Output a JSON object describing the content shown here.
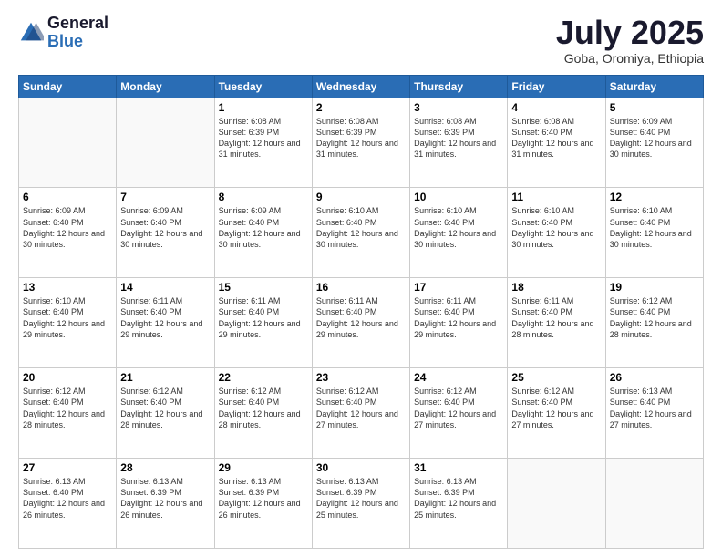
{
  "logo": {
    "general": "General",
    "blue": "Blue"
  },
  "title": "July 2025",
  "subtitle": "Goba, Oromiya, Ethiopia",
  "days_of_week": [
    "Sunday",
    "Monday",
    "Tuesday",
    "Wednesday",
    "Thursday",
    "Friday",
    "Saturday"
  ],
  "weeks": [
    [
      {
        "day": "",
        "info": ""
      },
      {
        "day": "",
        "info": ""
      },
      {
        "day": "1",
        "info": "Sunrise: 6:08 AM\nSunset: 6:39 PM\nDaylight: 12 hours and 31 minutes."
      },
      {
        "day": "2",
        "info": "Sunrise: 6:08 AM\nSunset: 6:39 PM\nDaylight: 12 hours and 31 minutes."
      },
      {
        "day": "3",
        "info": "Sunrise: 6:08 AM\nSunset: 6:39 PM\nDaylight: 12 hours and 31 minutes."
      },
      {
        "day": "4",
        "info": "Sunrise: 6:08 AM\nSunset: 6:40 PM\nDaylight: 12 hours and 31 minutes."
      },
      {
        "day": "5",
        "info": "Sunrise: 6:09 AM\nSunset: 6:40 PM\nDaylight: 12 hours and 30 minutes."
      }
    ],
    [
      {
        "day": "6",
        "info": "Sunrise: 6:09 AM\nSunset: 6:40 PM\nDaylight: 12 hours and 30 minutes."
      },
      {
        "day": "7",
        "info": "Sunrise: 6:09 AM\nSunset: 6:40 PM\nDaylight: 12 hours and 30 minutes."
      },
      {
        "day": "8",
        "info": "Sunrise: 6:09 AM\nSunset: 6:40 PM\nDaylight: 12 hours and 30 minutes."
      },
      {
        "day": "9",
        "info": "Sunrise: 6:10 AM\nSunset: 6:40 PM\nDaylight: 12 hours and 30 minutes."
      },
      {
        "day": "10",
        "info": "Sunrise: 6:10 AM\nSunset: 6:40 PM\nDaylight: 12 hours and 30 minutes."
      },
      {
        "day": "11",
        "info": "Sunrise: 6:10 AM\nSunset: 6:40 PM\nDaylight: 12 hours and 30 minutes."
      },
      {
        "day": "12",
        "info": "Sunrise: 6:10 AM\nSunset: 6:40 PM\nDaylight: 12 hours and 30 minutes."
      }
    ],
    [
      {
        "day": "13",
        "info": "Sunrise: 6:10 AM\nSunset: 6:40 PM\nDaylight: 12 hours and 29 minutes."
      },
      {
        "day": "14",
        "info": "Sunrise: 6:11 AM\nSunset: 6:40 PM\nDaylight: 12 hours and 29 minutes."
      },
      {
        "day": "15",
        "info": "Sunrise: 6:11 AM\nSunset: 6:40 PM\nDaylight: 12 hours and 29 minutes."
      },
      {
        "day": "16",
        "info": "Sunrise: 6:11 AM\nSunset: 6:40 PM\nDaylight: 12 hours and 29 minutes."
      },
      {
        "day": "17",
        "info": "Sunrise: 6:11 AM\nSunset: 6:40 PM\nDaylight: 12 hours and 29 minutes."
      },
      {
        "day": "18",
        "info": "Sunrise: 6:11 AM\nSunset: 6:40 PM\nDaylight: 12 hours and 28 minutes."
      },
      {
        "day": "19",
        "info": "Sunrise: 6:12 AM\nSunset: 6:40 PM\nDaylight: 12 hours and 28 minutes."
      }
    ],
    [
      {
        "day": "20",
        "info": "Sunrise: 6:12 AM\nSunset: 6:40 PM\nDaylight: 12 hours and 28 minutes."
      },
      {
        "day": "21",
        "info": "Sunrise: 6:12 AM\nSunset: 6:40 PM\nDaylight: 12 hours and 28 minutes."
      },
      {
        "day": "22",
        "info": "Sunrise: 6:12 AM\nSunset: 6:40 PM\nDaylight: 12 hours and 28 minutes."
      },
      {
        "day": "23",
        "info": "Sunrise: 6:12 AM\nSunset: 6:40 PM\nDaylight: 12 hours and 27 minutes."
      },
      {
        "day": "24",
        "info": "Sunrise: 6:12 AM\nSunset: 6:40 PM\nDaylight: 12 hours and 27 minutes."
      },
      {
        "day": "25",
        "info": "Sunrise: 6:12 AM\nSunset: 6:40 PM\nDaylight: 12 hours and 27 minutes."
      },
      {
        "day": "26",
        "info": "Sunrise: 6:13 AM\nSunset: 6:40 PM\nDaylight: 12 hours and 27 minutes."
      }
    ],
    [
      {
        "day": "27",
        "info": "Sunrise: 6:13 AM\nSunset: 6:40 PM\nDaylight: 12 hours and 26 minutes."
      },
      {
        "day": "28",
        "info": "Sunrise: 6:13 AM\nSunset: 6:39 PM\nDaylight: 12 hours and 26 minutes."
      },
      {
        "day": "29",
        "info": "Sunrise: 6:13 AM\nSunset: 6:39 PM\nDaylight: 12 hours and 26 minutes."
      },
      {
        "day": "30",
        "info": "Sunrise: 6:13 AM\nSunset: 6:39 PM\nDaylight: 12 hours and 25 minutes."
      },
      {
        "day": "31",
        "info": "Sunrise: 6:13 AM\nSunset: 6:39 PM\nDaylight: 12 hours and 25 minutes."
      },
      {
        "day": "",
        "info": ""
      },
      {
        "day": "",
        "info": ""
      }
    ]
  ]
}
